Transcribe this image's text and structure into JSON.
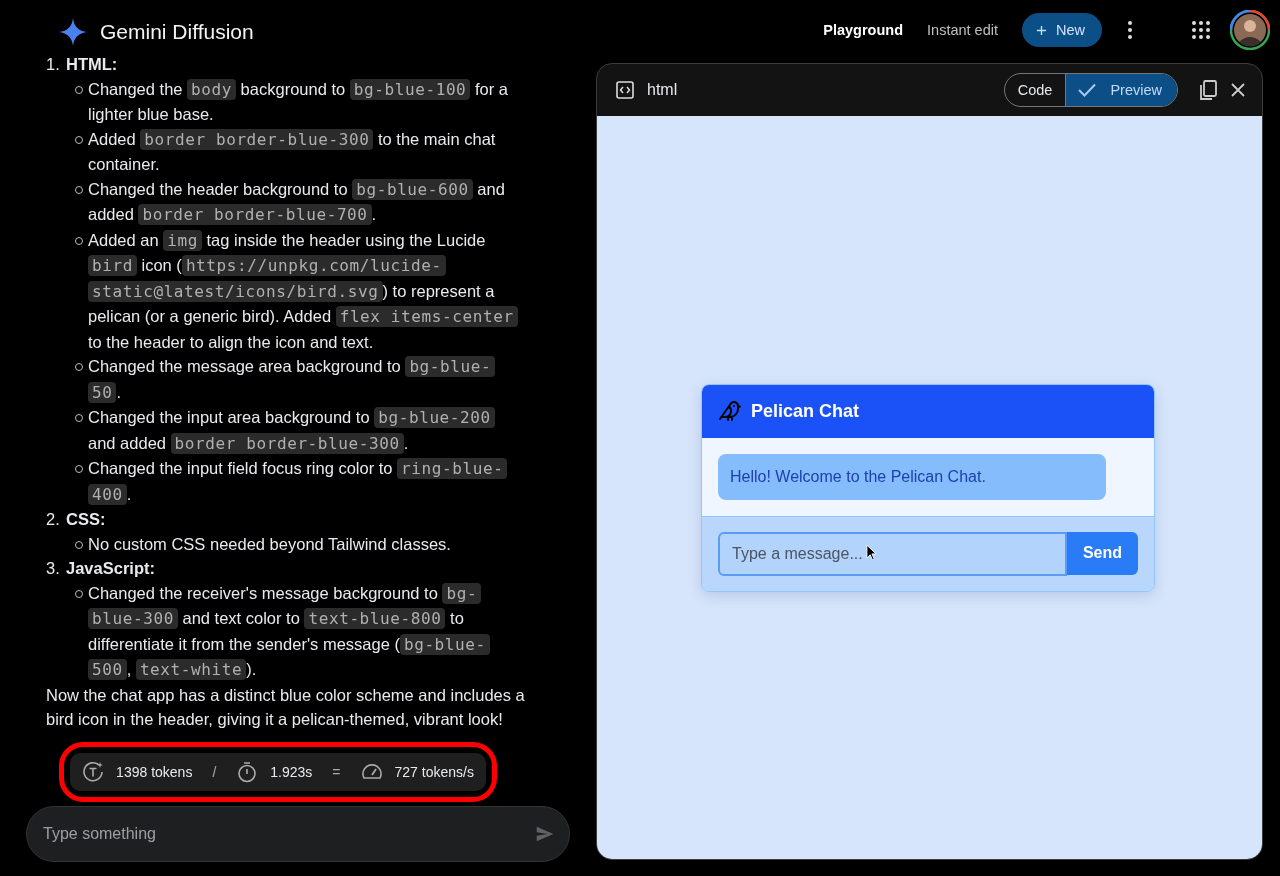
{
  "app": {
    "title": "Gemini Diffusion"
  },
  "nav": {
    "links": [
      {
        "label": "Playground",
        "selected": true
      },
      {
        "label": "Instant edit",
        "selected": false
      }
    ],
    "new_button": "New"
  },
  "response": {
    "sections": [
      {
        "number": "1.",
        "title": "HTML:",
        "items": [
          [
            "Changed the ",
            "body",
            " background to ",
            "bg-blue-100",
            " for a lighter blue base."
          ],
          [
            "Added ",
            "border border-blue-300",
            " to the main chat container."
          ],
          [
            "Changed the header background to ",
            "bg-blue-600",
            " and added ",
            "border border-blue-700",
            "."
          ],
          [
            "Added an ",
            "img",
            " tag inside the header using the Lucide ",
            "bird",
            " icon (",
            "https://unpkg.com/lucide-static@latest/icons/bird.svg",
            ") to represent a pelican (or a generic bird). Added ",
            "flex items-center",
            " to the header to align the icon and text."
          ],
          [
            "Changed the message area background to ",
            "bg-blue-50",
            "."
          ],
          [
            "Changed the input area background to ",
            "bg-blue-200",
            " and added ",
            "border border-blue-300",
            "."
          ],
          [
            "Changed the input field focus ring color to ",
            "ring-blue-400",
            "."
          ]
        ]
      },
      {
        "number": "2.",
        "title": "CSS:",
        "items": [
          [
            "No custom CSS needed beyond Tailwind classes."
          ]
        ]
      },
      {
        "number": "3.",
        "title": "JavaScript:",
        "items": [
          [
            "Changed the receiver's message background to ",
            "bg-blue-300",
            " and text color to ",
            "text-blue-800",
            " to differentiate it from the sender's message (",
            "bg-blue-500",
            ", ",
            "text-white",
            ")."
          ]
        ]
      }
    ],
    "closing": "Now the chat app has a distinct blue color scheme and includes a bird icon in the header, giving it a pelican-themed, vibrant look!"
  },
  "stats": {
    "tokens": "1398 tokens",
    "sep1": "/",
    "time": "1.923s",
    "sep2": "=",
    "rate": "727 tokens/s",
    "highlighted": true
  },
  "prompt": {
    "placeholder": "Type something"
  },
  "panel": {
    "title": "html",
    "tabs": [
      {
        "label": "Code",
        "selected": false
      },
      {
        "label": "Preview",
        "selected": true
      }
    ]
  },
  "preview": {
    "title": "Pelican Chat",
    "messages": [
      "Hello! Welcome to the Pelican Chat."
    ],
    "input_placeholder": "Type a message...",
    "send": "Send"
  }
}
